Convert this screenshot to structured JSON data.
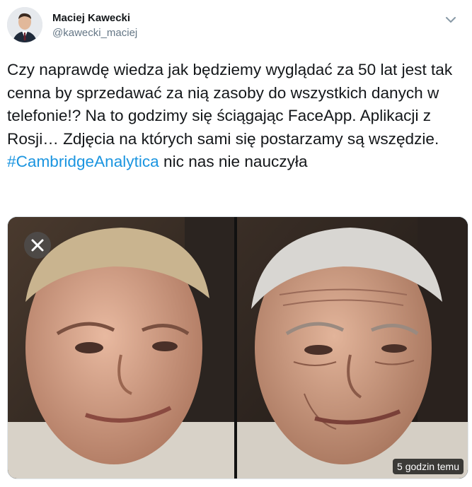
{
  "author": {
    "name": "Maciej Kawecki",
    "handle": "@kawecki_maciej"
  },
  "tweet": {
    "text_before": "Czy naprawdę wiedza jak będziemy wyglądać za 50 lat jest tak cenna by sprzedawać za nią zasoby do wszystkich danych w telefonie!? Na to godzimy się ściągając FaceApp. Aplikacji z Rosji… Zdjęcia na których sami się postarzamy są wszędzie. ",
    "hashtag": "#CambridgeAnalytica",
    "text_after": " nic nas nie nauczyła"
  },
  "media": {
    "timestamp": "5 godzin temu"
  },
  "colors": {
    "hashtag": "#1b95e0",
    "handle": "#657786",
    "text": "#14171a"
  },
  "icons": {
    "menu": "chevron-down-icon",
    "close": "close-icon"
  }
}
